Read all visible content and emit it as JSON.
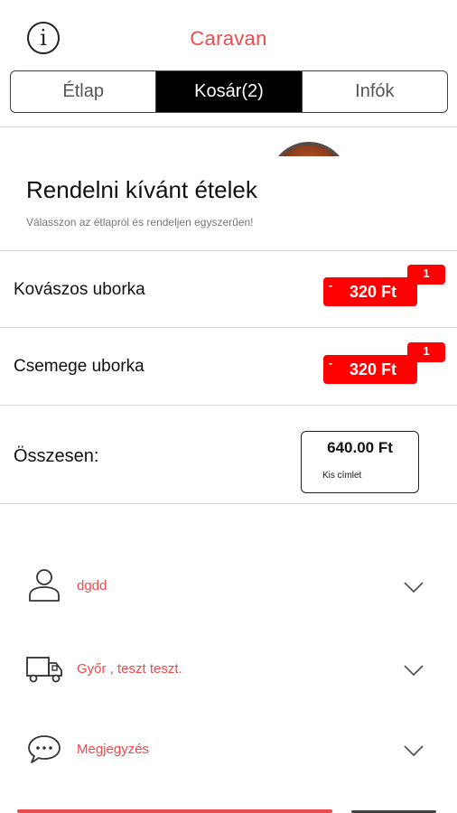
{
  "header": {
    "info_glyph": "i",
    "title": "Caravan"
  },
  "tabs": [
    {
      "label": "Étlap",
      "active": false
    },
    {
      "label": "Kosár(2)",
      "active": true
    },
    {
      "label": "Infók",
      "active": false
    }
  ],
  "cart": {
    "title": "Rendelni kívánt ételek",
    "subtitle": "Válasszon az étlapról és rendeljen egyszerűen!",
    "items": [
      {
        "name": "Kovászos uborka",
        "price": "320 Ft",
        "quantity": "1",
        "remove_glyph": "-"
      },
      {
        "name": "Csemege uborka",
        "price": "320 Ft",
        "quantity": "1",
        "remove_glyph": "-"
      }
    ],
    "total_label": "Összesen:",
    "total_amount": "640.00 Ft",
    "total_note": "Kis címlet"
  },
  "details": [
    {
      "icon": "user-icon",
      "text": "dgdd"
    },
    {
      "icon": "delivery-truck-icon",
      "text": "Győr , teszt teszt."
    },
    {
      "icon": "speech-bubble-icon",
      "text": "Megjegyzés"
    }
  ],
  "colors": {
    "accent": "#f04a4a",
    "price_red": "#ff0000",
    "tab_active_bg": "#000000"
  }
}
